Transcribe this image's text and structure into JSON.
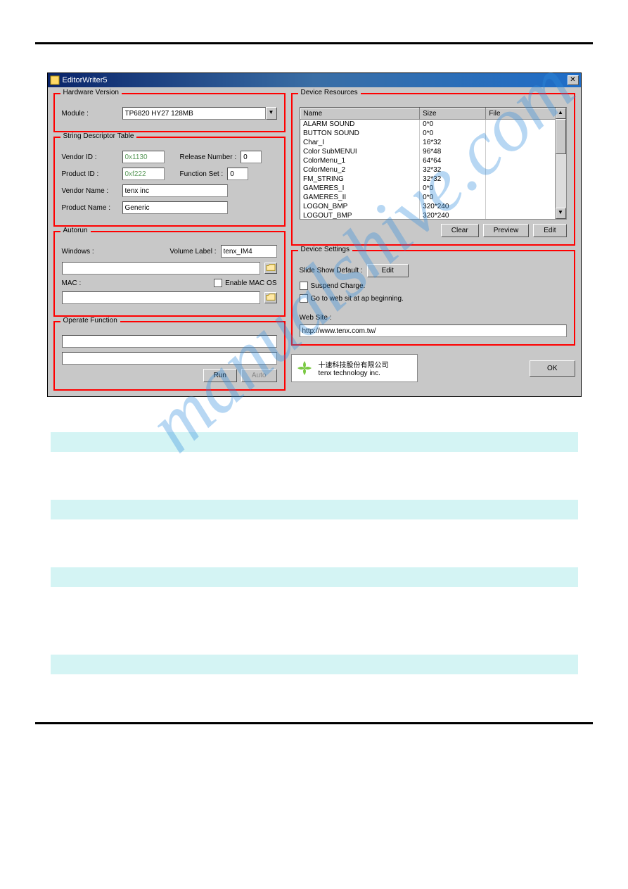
{
  "window": {
    "title": "EditorWriter5"
  },
  "hardware_version": {
    "title": "Hardware Version",
    "module_label": "Module :",
    "module_value": "TP6820 HY27 128MB"
  },
  "string_descriptor": {
    "title": "String Descriptor Table",
    "vendor_id_label": "Vendor ID :",
    "vendor_id_value": "0x1130",
    "release_number_label": "Release Number :",
    "release_number_value": "0",
    "product_id_label": "Product ID :",
    "product_id_value": "0xf222",
    "function_set_label": "Function Set :",
    "function_set_value": "0",
    "vendor_name_label": "Vendor Name :",
    "vendor_name_value": "tenx inc",
    "product_name_label": "Product Name :",
    "product_name_value": "Generic"
  },
  "autorun": {
    "title": "Autorun",
    "windows_label": "Windows :",
    "volume_label_label": "Volume Label :",
    "volume_label_value": "tenx_IM4",
    "mac_label": "MAC :",
    "enable_mac_os_label": "Enable MAC OS"
  },
  "operate_function": {
    "title": "Operate Function",
    "run_label": "Run",
    "auto_label": "Auto"
  },
  "device_resources": {
    "title": "Device Resources",
    "columns": {
      "name": "Name",
      "size": "Size",
      "file": "File"
    },
    "rows": [
      {
        "name": "ALARM SOUND",
        "size": "0*0",
        "file": ""
      },
      {
        "name": "BUTTON SOUND",
        "size": "0*0",
        "file": ""
      },
      {
        "name": "Char_I",
        "size": "16*32",
        "file": ""
      },
      {
        "name": "Color SubMENUI",
        "size": "96*48",
        "file": ""
      },
      {
        "name": "ColorMenu_1",
        "size": "64*64",
        "file": ""
      },
      {
        "name": "ColorMenu_2",
        "size": "32*32",
        "file": ""
      },
      {
        "name": "FM_STRING",
        "size": "32*32",
        "file": ""
      },
      {
        "name": "GAMERES_I",
        "size": "0*0",
        "file": ""
      },
      {
        "name": "GAMERES_II",
        "size": "0*0",
        "file": ""
      },
      {
        "name": "LOGON_BMP",
        "size": "320*240",
        "file": ""
      },
      {
        "name": "LOGOUT_BMP",
        "size": "320*240",
        "file": ""
      }
    ],
    "clear_label": "Clear",
    "preview_label": "Preview",
    "edit_label": "Edit"
  },
  "device_settings": {
    "title": "Device Settings",
    "slide_show_label": "Slide Show Default :",
    "edit_label": "Edit",
    "suspend_charge_label": "Suspend Charge.",
    "goto_web_label": "Go to web sit at ap beginning.",
    "web_site_label": "Web Site :",
    "web_site_value": "http://www.tenx.com.tw/"
  },
  "company": {
    "name_cn": "十速科技股份有限公司",
    "name_en": "tenx technology inc."
  },
  "ok_label": "OK",
  "watermark": "manualshive.com"
}
